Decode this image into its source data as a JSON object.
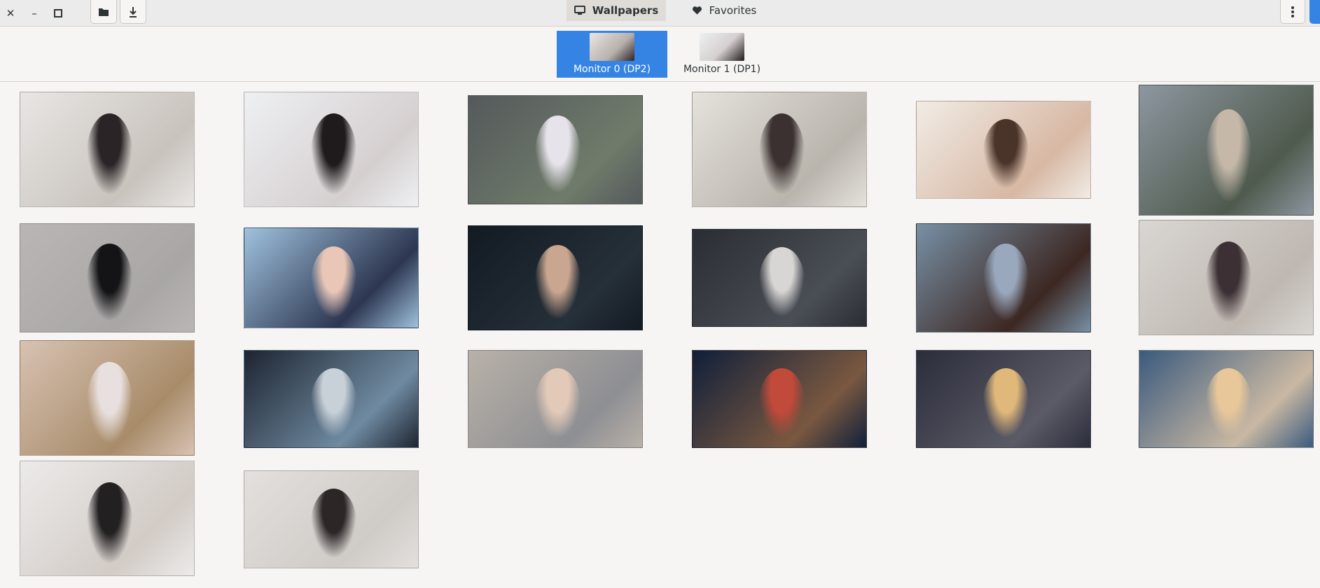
{
  "titlebar": {
    "close_glyph": "✕",
    "minimize_glyph": "–",
    "maximize_glyph": "□",
    "tabs": [
      {
        "label": "Wallpapers",
        "icon": "monitor-icon",
        "active": true
      },
      {
        "label": "Favorites",
        "icon": "heart-icon",
        "active": false
      }
    ],
    "accent": "#3584e4"
  },
  "monitors": [
    {
      "label": "Monitor 0 (DP2)",
      "selected": true
    },
    {
      "label": "Monitor 1 (DP1)",
      "selected": false
    }
  ],
  "wallpapers": [
    {
      "name": "girl-sitting-bed-window",
      "colors": [
        "#e8e6e4",
        "#c9c3bd",
        "#2a2426"
      ]
    },
    {
      "name": "girl-hugging-pillow",
      "colors": [
        "#eef0f2",
        "#d5cfd0",
        "#1f1a1c"
      ]
    },
    {
      "name": "anime-girl-ruins-flowers",
      "colors": [
        "#55595c",
        "#6f7b6a",
        "#e6e3ea"
      ]
    },
    {
      "name": "girl-classroom",
      "colors": [
        "#e5e1dc",
        "#b9b4ac",
        "#3a3130"
      ]
    },
    {
      "name": "girl-closeup-window",
      "colors": [
        "#f1ece6",
        "#d7b8a3",
        "#4a3328"
      ]
    },
    {
      "name": "woman-boat-lake",
      "colors": [
        "#8d97a0",
        "#4f5a4e",
        "#c5b8a8"
      ]
    },
    {
      "name": "girl-black-cap-mask",
      "colors": [
        "#b9b6b5",
        "#a9a6a6",
        "#141416"
      ]
    },
    {
      "name": "anime-short-hair-girl",
      "colors": [
        "#9fc2de",
        "#2d3650",
        "#e9c6b6"
      ]
    },
    {
      "name": "girl-braided-hair-dark",
      "colors": [
        "#121a22",
        "#263039",
        "#c9a690"
      ]
    },
    {
      "name": "white-hair-warrior",
      "colors": [
        "#2a2d33",
        "#4a4e55",
        "#d8d6d4"
      ]
    },
    {
      "name": "girl-on-sofa-dress",
      "colors": [
        "#7891a6",
        "#3c2722",
        "#9aa8bd"
      ]
    },
    {
      "name": "girl-sailor-desk",
      "colors": [
        "#d9d6d3",
        "#bfb8b1",
        "#3d3035"
      ]
    },
    {
      "name": "two-girls-gym-clothes",
      "colors": [
        "#d7c2b2",
        "#a88c6a",
        "#e8e0de"
      ]
    },
    {
      "name": "anime-girl-lying-armor",
      "colors": [
        "#1d2430",
        "#6f8aa1",
        "#c8d0d8"
      ]
    },
    {
      "name": "silver-hair-elf",
      "colors": [
        "#b9b1a8",
        "#8e8f93",
        "#e2c9b8"
      ]
    },
    {
      "name": "planet-landscape",
      "colors": [
        "#0f1f3a",
        "#7a5840",
        "#c24a3a"
      ]
    },
    {
      "name": "veiled-girl-bokeh",
      "colors": [
        "#2b2d3a",
        "#5b5a67",
        "#e0b87a"
      ]
    },
    {
      "name": "blonde-girl-feathers",
      "colors": [
        "#3a5a7e",
        "#c9b8a3",
        "#e8c89a"
      ]
    },
    {
      "name": "girl-bed-stockings",
      "colors": [
        "#ecebea",
        "#d2cbc6",
        "#232022"
      ]
    },
    {
      "name": "android-sword-sketch",
      "colors": [
        "#e3e0dd",
        "#cfcbc7",
        "#2c2626"
      ]
    }
  ]
}
